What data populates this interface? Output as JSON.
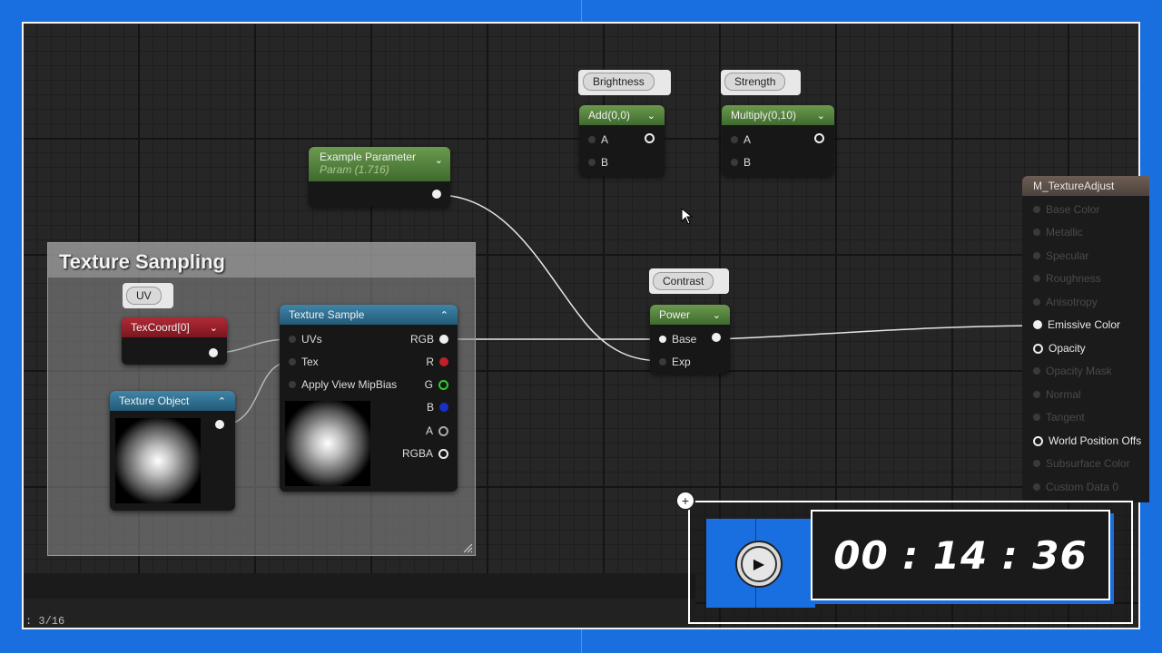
{
  "graph": {
    "comment_title": "Texture Sampling",
    "nodes": {
      "brightness": {
        "tag": "Brightness",
        "title": "Add(0,0)",
        "pin_a": "A",
        "pin_b": "B"
      },
      "strength": {
        "tag": "Strength",
        "title": "Multiply(0,10)",
        "pin_a": "A",
        "pin_b": "B"
      },
      "example_param": {
        "title": "Example Parameter",
        "subtitle": "Param (1.716)"
      },
      "contrast": {
        "tag": "Contrast",
        "title": "Power",
        "pin_base": "Base",
        "pin_exp": "Exp"
      },
      "uv": {
        "tag": "UV",
        "title": "TexCoord[0]"
      },
      "texture_object": {
        "title": "Texture Object"
      },
      "texture_sample": {
        "title": "Texture Sample",
        "inputs": [
          "UVs",
          "Tex",
          "Apply View MipBias"
        ],
        "outputs": [
          "RGB",
          "R",
          "G",
          "B",
          "A",
          "RGBA"
        ]
      },
      "material_output": {
        "title": "M_TextureAdjust",
        "pins": [
          "Base Color",
          "Metallic",
          "Specular",
          "Roughness",
          "Anisotropy",
          "Emissive Color",
          "Opacity",
          "Opacity Mask",
          "Normal",
          "Tangent",
          "World Position Offs",
          "Subsurface Color",
          "Custom Data 0"
        ]
      }
    }
  },
  "status": {
    "text": ": 3/16"
  },
  "timer": {
    "time": "00 : 14 : 36",
    "play_icon": "play-icon",
    "add_icon": "plus-icon"
  },
  "colors": {
    "accent": "#1a6fe0",
    "node_green": "#5a8a42",
    "node_blue": "#2e6f90",
    "node_red": "#9a1f2b",
    "pin_r": "#c0202a",
    "pin_g": "#2ecc2e",
    "pin_b": "#1a2fc8"
  }
}
